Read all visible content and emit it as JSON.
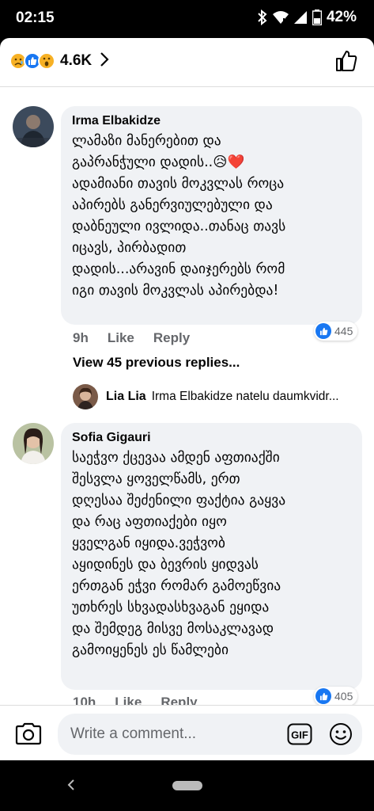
{
  "status_bar": {
    "time": "02:15",
    "battery": "42%"
  },
  "reactions": {
    "count": "4.6K",
    "emojis": [
      "sad-emoji",
      "like-emoji",
      "wow-emoji"
    ]
  },
  "comments": [
    {
      "author": "Irma Elbakidze",
      "text": "ლამაზი მანერებით და\nგაპრანჭული დადის..😥❤️\nადამიანი თავის მოკვლას როცა\nაპირებს განერვიულებული და\nდაბნეული ივლიდა..თანაც თავს\nიცავს, პირბადით\nდადის...არავინ დაიჯერებს რომ\nიგი თავის მოკვლას აპირებდა!",
      "time": "9h",
      "like_label": "Like",
      "reply_label": "Reply",
      "likes": "445"
    },
    {
      "author": "Sofia Gigauri",
      "text": "საეჭვო ქცევაა ამდენ აფთიაქში\nშესვლა ყოველწამს, ერთ\nდღესაა შეძენილი ფაქტია გაყვა\nდა რაც აფთიაქები იყო\nყველგან იყიდა.ვეჭვობ\nაყიდინეს და ბევრის ყიდვას\nერთგან ეჭვი რომარ გამოეწვია\nუთხრეს სხვადასხვაგან ეყიდა\nდა შემდეგ მისვე მოსაკლავად\nგამოიყენეს ეს წამლები",
      "time": "10h",
      "like_label": "Like",
      "reply_label": "Reply",
      "likes": "405"
    }
  ],
  "view_previous": "View 45 previous replies...",
  "reply_preview": {
    "author": "Lia Lia",
    "text": "Irma Elbakidze natelu daumkvidr..."
  },
  "composer": {
    "placeholder": "Write a comment...",
    "gif_label": "GIF"
  },
  "colors": {
    "accent": "#1877f2",
    "bubble": "#f0f2f5",
    "meta_text": "#65676b"
  }
}
